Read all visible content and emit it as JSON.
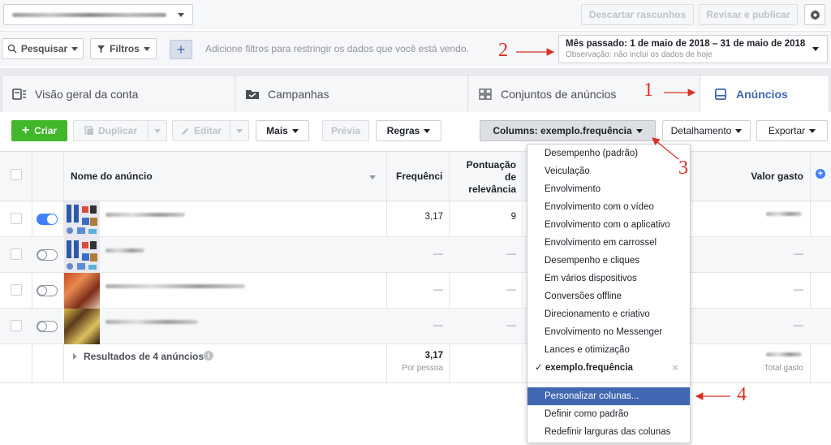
{
  "topbar": {
    "discard_label": "Descartar rascunhos",
    "review_label": "Revisar e publicar"
  },
  "filterbar": {
    "search_label": "Pesquisar",
    "filters_label": "Filtros",
    "hint": "Adicione filtros para restringir os dados que você está vendo.",
    "date_range": "Mês passado: 1 de maio de 2018 – 31 de maio de 2018",
    "date_note": "Observação: não inclui os dados de hoje"
  },
  "tabs": {
    "overview": "Visão geral da conta",
    "campaigns": "Campanhas",
    "adsets": "Conjuntos de anúncios",
    "ads": "Anúncios"
  },
  "toolbar": {
    "create": "Criar",
    "duplicate": "Duplicar",
    "edit": "Editar",
    "more": "Mais",
    "preview": "Prévia",
    "rules": "Regras",
    "columns": "Columns: exemplo.frequência",
    "breakdown": "Detalhamento",
    "export": "Exportar"
  },
  "table": {
    "headers": {
      "ad_name": "Nome do anúncio",
      "frequency": "Frequênci",
      "relevance_1": "Pontuação",
      "relevance_2": "de",
      "relevance_3": "relevância",
      "spent": "Valor gasto"
    },
    "rows": [
      {
        "frequency": "3,17",
        "relevance": "9"
      },
      {
        "frequency": "—",
        "relevance": "—"
      },
      {
        "frequency": "—",
        "relevance": "—"
      },
      {
        "frequency": "—",
        "relevance": "—"
      }
    ],
    "summary": {
      "label": "Resultados de 4 anúncios",
      "frequency": "3,17",
      "frequency_sub": "Por pessoa",
      "spent_sub": "Total gasto",
      "dash": "—"
    }
  },
  "menu": {
    "items": [
      "Desempenho (padrão)",
      "Veiculação",
      "Envolvimento",
      "Envolvimento com o vídeo",
      "Envolvimento com o aplicativo",
      "Envolvimento em carrossel",
      "Desempenho e cliques",
      "Em vários dispositivos",
      "Conversões offline",
      "Direcionamento e criativo",
      "Envolvimento no Messenger",
      "Lances e otimização",
      "exemplo.frequência"
    ],
    "checkmark": "✓",
    "close": "×",
    "actions": [
      "Personalizar colunas...",
      "Definir como padrão",
      "Redefinir larguras das colunas"
    ]
  },
  "annotations": [
    "1",
    "2",
    "3",
    "4"
  ],
  "colors": {
    "accent": "#4267b2",
    "create": "#42b72a",
    "annotation": "#d93025",
    "toggle_on": "#4080ff"
  }
}
